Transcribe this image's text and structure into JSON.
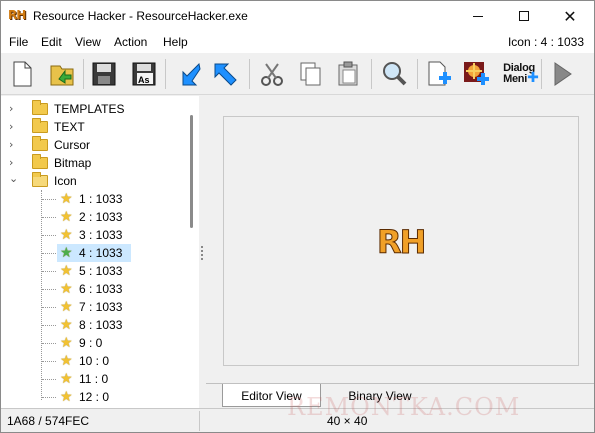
{
  "window": {
    "title": "Resource Hacker - ResourceHacker.exe",
    "app_icon_text": "RH",
    "minimize_glyph": "—",
    "maximize_glyph": "☐",
    "close_glyph": "✕"
  },
  "menubar": {
    "items": [
      "File",
      "Edit",
      "View",
      "Action",
      "Help"
    ],
    "status": "Icon : 4 : 1033"
  },
  "toolbar": {
    "buttons": [
      {
        "name": "new-file-icon"
      },
      {
        "name": "open-file-icon"
      },
      {
        "name": "save-icon"
      },
      {
        "name": "save-as-icon",
        "label": "As"
      },
      {
        "name": "import-icon"
      },
      {
        "name": "export-icon"
      },
      {
        "name": "cut-icon"
      },
      {
        "name": "copy-icon"
      },
      {
        "name": "paste-icon"
      },
      {
        "name": "search-icon"
      },
      {
        "name": "add-resource-icon"
      },
      {
        "name": "add-image-icon"
      },
      {
        "name": "dialog-menu-icon",
        "label_line1": "Dialog",
        "label_line2": "Meni"
      },
      {
        "name": "run-icon"
      }
    ]
  },
  "tree": {
    "folders": [
      {
        "label": "TEMPLATES",
        "chevron": "›"
      },
      {
        "label": "TEXT",
        "chevron": "›"
      },
      {
        "label": "Cursor",
        "chevron": "›"
      },
      {
        "label": "Bitmap",
        "chevron": "›"
      },
      {
        "label": "Icon",
        "chevron": "⌄"
      }
    ],
    "icons": [
      {
        "label": "1 : 1033",
        "selected": false
      },
      {
        "label": "2 : 1033",
        "selected": false
      },
      {
        "label": "3 : 1033",
        "selected": false
      },
      {
        "label": "4 : 1033",
        "selected": true
      },
      {
        "label": "5 : 1033",
        "selected": false
      },
      {
        "label": "6 : 1033",
        "selected": false
      },
      {
        "label": "7 : 1033",
        "selected": false
      },
      {
        "label": "8 : 1033",
        "selected": false
      },
      {
        "label": "9 : 0",
        "selected": false
      },
      {
        "label": "10 : 0",
        "selected": false
      },
      {
        "label": "11 : 0",
        "selected": false
      },
      {
        "label": "12 : 0",
        "selected": false
      }
    ]
  },
  "preview": {
    "logo_text": "RH",
    "tabs": [
      "Editor View",
      "Binary View"
    ],
    "active_tab": "Editor View"
  },
  "statusbar": {
    "left": "1A68 / 574FEC",
    "right": "40 × 40"
  },
  "watermark": "REMONTKA.COM",
  "colors": {
    "selection": "#cce8ff",
    "folder": "#f2c94c",
    "star": "#f2c232",
    "logo": "#f0a028",
    "accent_blue": "#1e90ff"
  }
}
